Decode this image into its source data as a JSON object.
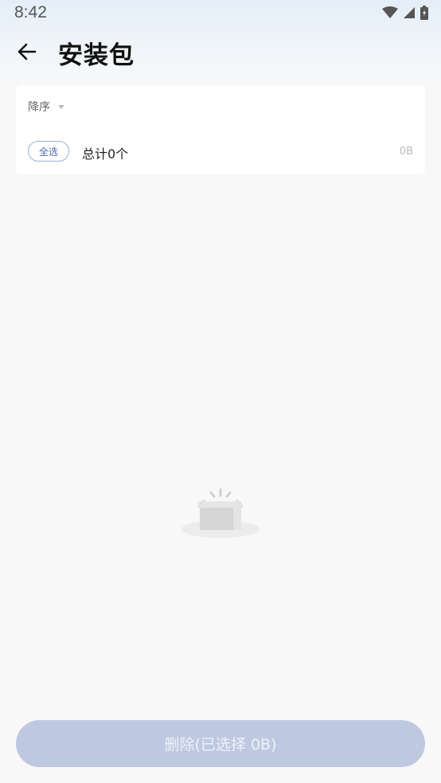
{
  "status_bar": {
    "time": "8:42"
  },
  "header": {
    "title": "安装包"
  },
  "list": {
    "sort_label": "降序",
    "select_all_label": "全选",
    "total_label": "总计0个",
    "total_size": "0B"
  },
  "footer": {
    "delete_label": "删除(已选择 0B)"
  },
  "colors": {
    "accent": "#4a6aa8",
    "button_disabled": "#bec9e1",
    "background": "#f8f8f9"
  }
}
